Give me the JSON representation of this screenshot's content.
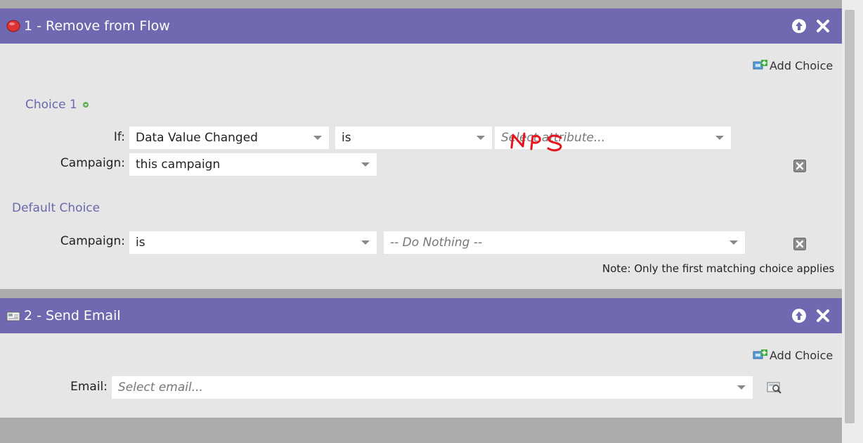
{
  "steps": [
    {
      "title": "1 - Remove from Flow",
      "icon": "red-circle-icon",
      "add_choice_label": "Add Choice",
      "choice_1": {
        "label": "Choice 1",
        "if_label": "If:",
        "condition": "Data Value Changed",
        "operator": "is",
        "attribute_placeholder": "Select attribute...",
        "campaign_label": "Campaign:",
        "campaign_value": "this campaign"
      },
      "default_choice": {
        "label": "Default Choice",
        "campaign_label": "Campaign:",
        "campaign_operator": "is",
        "campaign_value": "-- Do Nothing --"
      },
      "note": "Note: Only the first matching choice applies"
    },
    {
      "title": "2 - Send Email",
      "icon": "email-icon",
      "add_choice_label": "Add Choice",
      "email_label": "Email:",
      "email_placeholder": "Select email..."
    }
  ],
  "annotation": {
    "handwritten_text": "NPS",
    "color": "#e8141c"
  },
  "colors": {
    "header": "#7068b0",
    "panel": "#e6e6e6",
    "link": "#6a68ae",
    "background": "#acacac"
  }
}
